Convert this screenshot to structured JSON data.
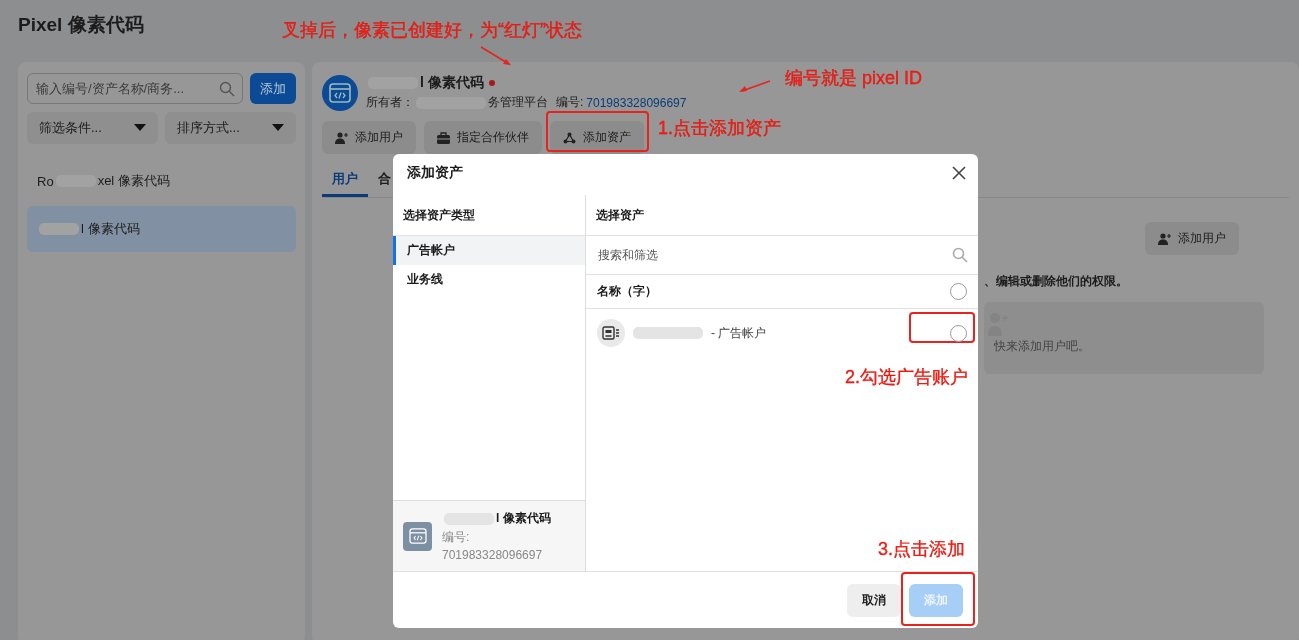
{
  "page_title": "Pixel 像素代码",
  "sidebar": {
    "search": {
      "placeholder": "输入编号/资产名称/商务..."
    },
    "add_button": "添加",
    "filters": [
      "筛选条件...",
      "排序方式..."
    ],
    "items": [
      {
        "prefix": "Ro",
        "name": "xel 像素代码",
        "selected": false
      },
      {
        "name": "l 像素代码",
        "selected": true
      }
    ]
  },
  "detail": {
    "name": "l 像素代码",
    "alert": true,
    "owner_label": "所有者：",
    "owner": "务管理平台",
    "id_label": "编号:",
    "id": "701983328096697",
    "buttons": [
      {
        "kind": "user",
        "label": "添加用户"
      },
      {
        "kind": "briefcase",
        "label": "指定合作伙伴"
      },
      {
        "kind": "asset",
        "label": "添加资产"
      }
    ],
    "tabs": [
      {
        "label": "用户",
        "selected": true
      },
      {
        "label": "合",
        "selected": false
      }
    ],
    "add_user_button": "添加用户",
    "description": "、编辑或删除他们的权限。",
    "empty_text": "快来添加用户吧。"
  },
  "modal": {
    "title": "添加资产",
    "types_heading": "选择资产类型",
    "types": [
      {
        "label": "广告帐户",
        "selected": true
      },
      {
        "label": "业务线",
        "selected": false
      }
    ],
    "assets_heading": "选择资产",
    "search": {
      "placeholder": "搜索和筛选"
    },
    "header_row": {
      "label": "名称（字）",
      "checked": false
    },
    "assets": [
      {
        "name": "- 广告帐户",
        "checked": false
      }
    ],
    "summary": {
      "name": "l 像素代码",
      "id_label": "编号:",
      "id": "701983328096697"
    },
    "cancel_button": "取消",
    "add_button": {
      "label": "添加",
      "disabled": true
    }
  },
  "annotations": [
    "叉掉后，像素已创建好，为“红灯”状态",
    "编号就是 pixel ID",
    "1.点击添加资产",
    "2.勾选广告账户",
    "3.点击添加"
  ]
}
